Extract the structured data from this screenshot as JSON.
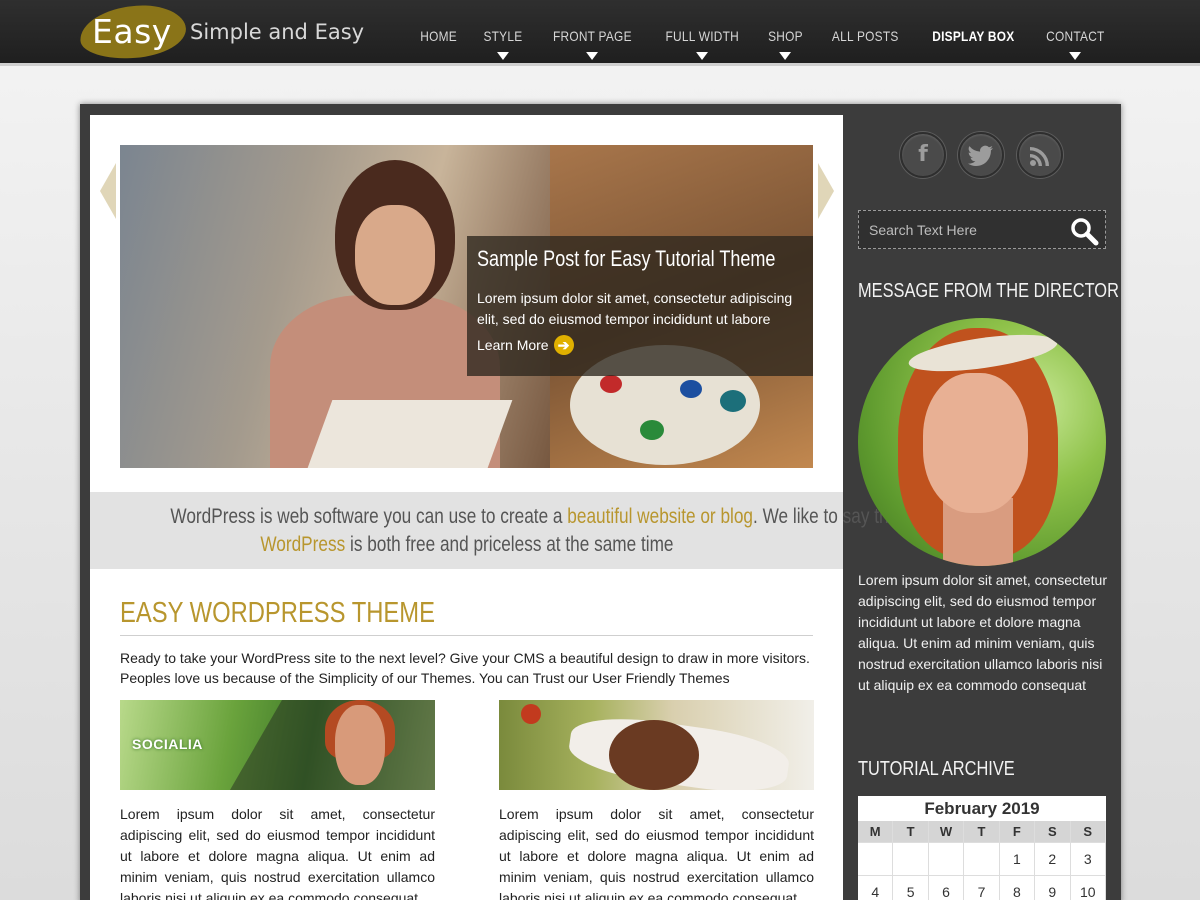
{
  "header": {
    "logo_text": "Easy",
    "tagline": "Simple and Easy",
    "nav": [
      {
        "label": "HOME",
        "active": false,
        "caret": false
      },
      {
        "label": "STYLE",
        "active": false,
        "caret": true
      },
      {
        "label": "FRONT PAGE",
        "active": false,
        "caret": true
      },
      {
        "label": "FULL WIDTH",
        "active": false,
        "caret": true
      },
      {
        "label": "SHOP",
        "active": false,
        "caret": true
      },
      {
        "label": "ALL POSTS",
        "active": false,
        "caret": false
      },
      {
        "label": "DISPLAY BOX",
        "active": true,
        "caret": false
      },
      {
        "label": "CONTACT",
        "active": false,
        "caret": true
      }
    ]
  },
  "slider": {
    "title": "Sample Post for Easy Tutorial Theme",
    "text": "Lorem ipsum dolor sit amet, consectetur adipiscing elit, sed do eiusmod tempor incididunt ut labore",
    "button": "Learn More"
  },
  "tagline": {
    "part1": "WordPress is web software you can use to create a ",
    "link1": "beautiful website or blog",
    "part2": ". We like to say that",
    "link2": "WordPress",
    "part3": " is both free and priceless at the same time"
  },
  "section": {
    "title": "EASY WORDPRESS THEME",
    "intro": "Ready to take your WordPress site to the next level? Give your CMS a beautiful design to draw in more visitors. Peoples love us because of the Simplicity of our Themes. You can Trust our User Friendly Themes",
    "thumb1_logo": "SOCIALIA",
    "col1_text": "Lorem ipsum dolor sit amet, consectetur adipiscing elit, sed do eiusmod tempor incididunt ut labore et dolore magna aliqua. Ut enim ad minim veniam, quis nostrud exercitation ullamco laboris nisi ut aliquip ex ea commodo consequat",
    "col2_text": "Lorem ipsum dolor sit amet, consectetur adipiscing elit, sed do eiusmod tempor incididunt ut labore et dolore magna aliqua. Ut enim ad minim veniam, quis nostrud exercitation ullamco laboris nisi ut aliquip ex ea commodo consequat"
  },
  "sidebar": {
    "social_icons": [
      "facebook-icon",
      "twitter-icon",
      "rss-icon"
    ],
    "social_glyphs": {
      "facebook": "f",
      "twitter": "t",
      "rss": "◉"
    },
    "search_placeholder": "Search Text Here",
    "director_title": "MESSAGE FROM THE DIRECTOR",
    "director_text": "Lorem ipsum dolor sit amet, consectetur adipiscing elit, sed do eiusmod tempor incididunt ut labore et dolore magna aliqua. Ut enim ad minim veniam, quis nostrud exercitation ullamco laboris nisi ut aliquip ex ea commodo consequat",
    "archive_title": "TUTORIAL ARCHIVE",
    "calendar": {
      "month": "February 2019",
      "days": [
        "M",
        "T",
        "W",
        "T",
        "F",
        "S",
        "S"
      ],
      "week1": [
        "",
        "",
        "",
        "",
        "1",
        "2",
        "3"
      ],
      "week2": [
        "4",
        "5",
        "6",
        "7",
        "8",
        "9",
        "10"
      ]
    }
  },
  "colors": {
    "accent_gold": "#b8962e",
    "header_bg": "#262626",
    "sidebar_bg": "#3c3c3c",
    "logo_oval": "#8a7418"
  }
}
